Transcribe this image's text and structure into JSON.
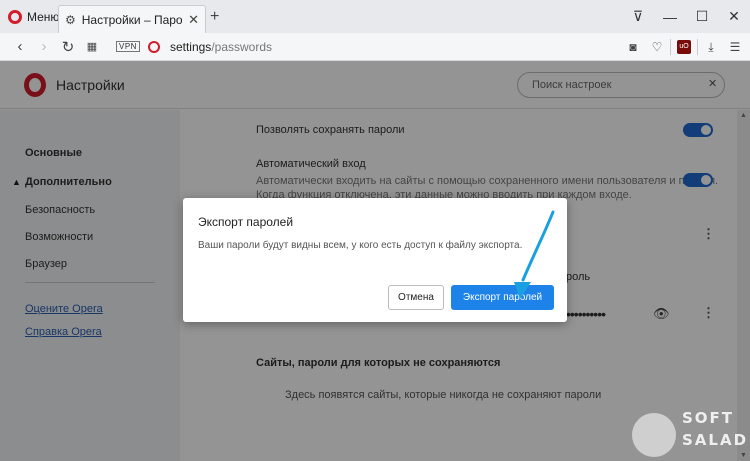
{
  "browser": {
    "menu_label": "Меню",
    "tab_title": "Настройки – Пароли",
    "tab_close": "✕",
    "new_tab": "+",
    "win_minimize_alt": "⊽",
    "win_minimize": "—",
    "win_maximize": "☐",
    "win_close": "✕",
    "vpn_label": "VPN",
    "url_host": "settings",
    "url_path": "/passwords",
    "ublock_label": "uO"
  },
  "settings": {
    "title": "Настройки",
    "search_placeholder": "Поиск настроек",
    "sidebar": {
      "basic": "Основные",
      "advanced": "Дополнительно",
      "security": "Безопасность",
      "features": "Возможности",
      "browser": "Браузер",
      "rate_link": "Оцените Opera",
      "help_link": "Справка Opera"
    },
    "content": {
      "allow_save_label": "Позволять сохранять пароли",
      "auto_signin_label": "Автоматический вход",
      "auto_signin_desc_1": "Автоматически входить на сайты с помощью сохраненного имени пользователя и пароля.",
      "auto_signin_desc_2": "Когда функция отключена, эти данные можно вводить при каждом входе.",
      "hidden_fragment": "роль",
      "password_mask": "••••••••••",
      "never_saved_title": "Сайты, пароли для которых не сохраняются",
      "never_saved_empty": "Здесь появятся сайты, которые никогда не сохраняют пароли"
    }
  },
  "dialog": {
    "title": "Экспорт паролей",
    "body": "Ваши пароли будут видны всем, у кого есть доступ к файлу экспорта.",
    "cancel_label": "Отмена",
    "export_label": "Экспорт паролей"
  },
  "watermark": {
    "line1": "SOFT",
    "line2": "SALAD"
  },
  "colors": {
    "opera_red": "#d11d2c",
    "accent_blue": "#1e83e8",
    "toggle_blue": "#1f6ad0",
    "annotation_arrow": "#1a9fe0"
  }
}
